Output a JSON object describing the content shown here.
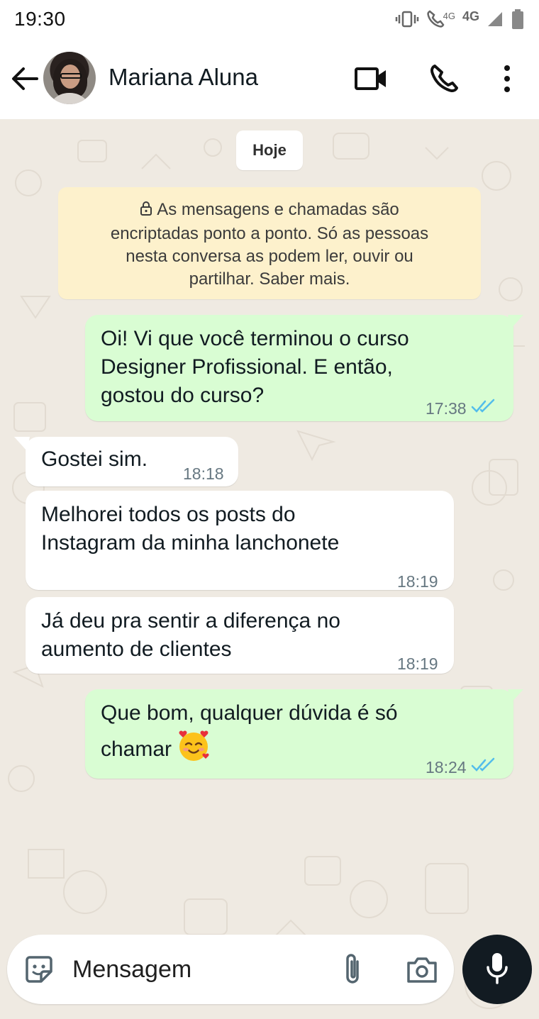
{
  "status_bar": {
    "time": "19:30",
    "network_small": "4G",
    "network": "4G"
  },
  "header": {
    "contact_name": "Mariana Aluna"
  },
  "chat": {
    "date_chip": "Hoje",
    "encryption_notice": {
      "lines": [
        "As mensagens e chamadas são",
        "encriptadas ponto a ponto. Só as pessoas",
        "nesta conversa as podem ler, ouvir ou",
        "partilhar. Saber mais."
      ]
    },
    "messages": [
      {
        "direction": "out",
        "lines": [
          "Oi! Vi que você terminou o curso",
          "Designer Profissional. E então,",
          "gostou do curso?"
        ],
        "time": "17:38",
        "status": "read"
      },
      {
        "direction": "in",
        "lines": [
          "Gostei sim."
        ],
        "time": "18:18"
      },
      {
        "direction": "in",
        "lines": [
          "Melhorei todos os posts do",
          "Instagram da minha lanchonete"
        ],
        "time": "18:19"
      },
      {
        "direction": "in",
        "lines": [
          "Já deu pra sentir a diferença no",
          "aumento de clientes"
        ],
        "time": "18:19"
      },
      {
        "direction": "out",
        "lines": [
          "Que bom, qualquer dúvida é só",
          "chamar"
        ],
        "emoji": "smiling-face-with-hearts",
        "time": "18:24",
        "status": "read"
      }
    ]
  },
  "input": {
    "placeholder": "Mensagem"
  },
  "colors": {
    "outgoing_bubble": "#d9fdd3",
    "incoming_bubble": "#ffffff",
    "read_ticks": "#53bdeb",
    "wallpaper": "#efeae2",
    "encryption_bg": "#fdf1cc"
  }
}
